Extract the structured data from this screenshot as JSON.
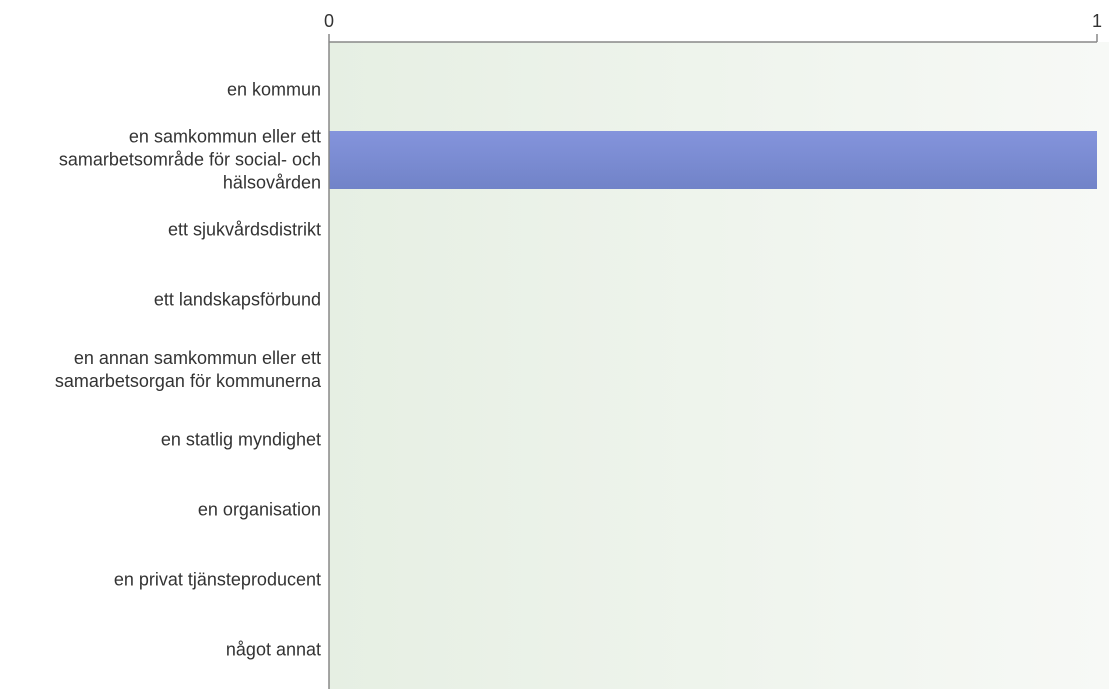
{
  "chart_data": {
    "type": "bar",
    "orientation": "horizontal",
    "categories": [
      "en kommun",
      "en samkommun eller ett samarbetsområde för social- och hälsovården",
      "ett sjukvårdsdistrikt",
      "ett landskapsförbund",
      "en annan samkommun eller ett samarbetsorgan för kommunerna",
      "en statlig myndighet",
      "en organisation",
      "en privat tjänsteproducent",
      "något annat"
    ],
    "category_lines": [
      [
        "en kommun"
      ],
      [
        "en samkommun eller ett",
        "samarbetsområde för social- och",
        "hälsovården"
      ],
      [
        "ett sjukvårdsdistrikt"
      ],
      [
        "ett landskapsförbund"
      ],
      [
        "en annan samkommun eller ett",
        "samarbetsorgan för kommunerna"
      ],
      [
        "en statlig myndighet"
      ],
      [
        "en organisation"
      ],
      [
        "en privat tjänsteproducent"
      ],
      [
        "något annat"
      ]
    ],
    "values": [
      0,
      1,
      0,
      0,
      0,
      0,
      0,
      0,
      0
    ],
    "xlim": [
      0,
      1
    ],
    "xticks": [
      "0",
      "1"
    ],
    "axis_position": "top",
    "grid": false,
    "bar_color": "#7b8bd4",
    "plot_background": "#eef3ec"
  }
}
